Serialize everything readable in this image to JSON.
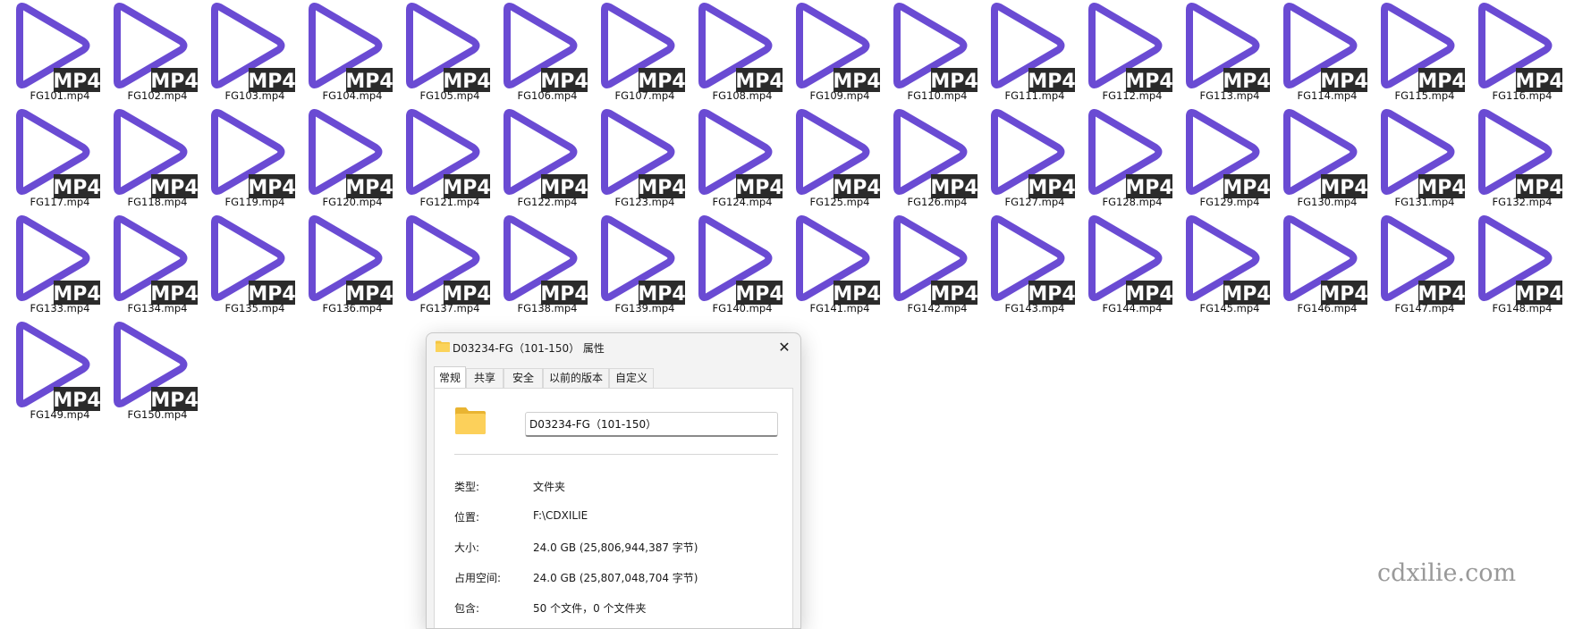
{
  "files": [
    "FG101.mp4",
    "FG102.mp4",
    "FG103.mp4",
    "FG104.mp4",
    "FG105.mp4",
    "FG106.mp4",
    "FG107.mp4",
    "FG108.mp4",
    "FG109.mp4",
    "FG110.mp4",
    "FG111.mp4",
    "FG112.mp4",
    "FG113.mp4",
    "FG114.mp4",
    "FG115.mp4",
    "FG116.mp4",
    "FG117.mp4",
    "FG118.mp4",
    "FG119.mp4",
    "FG120.mp4",
    "FG121.mp4",
    "FG122.mp4",
    "FG123.mp4",
    "FG124.mp4",
    "FG125.mp4",
    "FG126.mp4",
    "FG127.mp4",
    "FG128.mp4",
    "FG129.mp4",
    "FG130.mp4",
    "FG131.mp4",
    "FG132.mp4",
    "FG133.mp4",
    "FG134.mp4",
    "FG135.mp4",
    "FG136.mp4",
    "FG137.mp4",
    "FG138.mp4",
    "FG139.mp4",
    "FG140.mp4",
    "FG141.mp4",
    "FG142.mp4",
    "FG143.mp4",
    "FG144.mp4",
    "FG145.mp4",
    "FG146.mp4",
    "FG147.mp4",
    "FG148.mp4",
    "FG149.mp4",
    "FG150.mp4"
  ],
  "file_icon": {
    "name": "play-icon",
    "badge": "MP4",
    "accent_color": "#6a4bd3",
    "badge_color": "#2b2b2b"
  },
  "dialog": {
    "title": "D03234-FG（101-150） 属性",
    "close_glyph": "✕",
    "tabs": [
      "常规",
      "共享",
      "安全",
      "以前的版本",
      "自定义"
    ],
    "active_tab": "常规",
    "folder_name": "D03234-FG（101-150）",
    "rows": [
      {
        "key": "类型:",
        "value": "文件夹"
      },
      {
        "key": "位置:",
        "value": "F:\\CDXILIE"
      },
      {
        "key": "大小:",
        "value": "24.0 GB (25,806,944,387 字节)"
      },
      {
        "key": "占用空间:",
        "value": "24.0 GB (25,807,048,704 字节)"
      },
      {
        "key": "包含:",
        "value": "50 个文件，0 个文件夹"
      }
    ]
  },
  "watermark": "cdxilie.com"
}
